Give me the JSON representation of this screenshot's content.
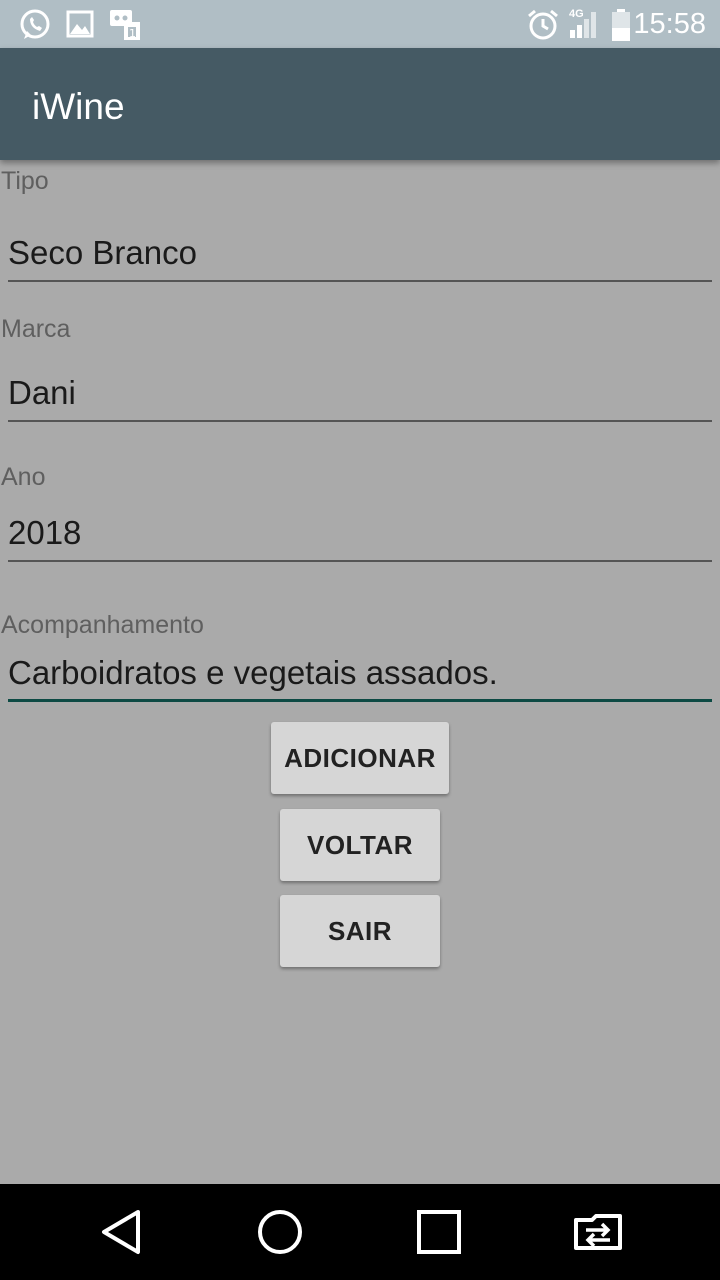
{
  "status_bar": {
    "time": "15:58",
    "network": "4G",
    "icons": [
      "whatsapp-icon",
      "image-icon",
      "messages-icon",
      "alarm-icon",
      "signal-icon",
      "battery-icon"
    ]
  },
  "app_bar": {
    "title": "iWine"
  },
  "form": {
    "tipo": {
      "label": "Tipo",
      "value": "Seco Branco"
    },
    "marca": {
      "label": "Marca",
      "value": "Dani"
    },
    "ano": {
      "label": "Ano",
      "value": "2018"
    },
    "acompanhamento": {
      "label": "Acompanhamento",
      "value": "Carboidratos e vegetais assados."
    }
  },
  "buttons": {
    "adicionar": "ADICIONAR",
    "voltar": "VOLTAR",
    "sair": "SAIR"
  },
  "nav_bar": {
    "icons": [
      "back-icon",
      "home-icon",
      "recents-icon",
      "switch-app-icon"
    ]
  },
  "colors": {
    "status_bar": "#b0bec5",
    "app_bar": "#455a64",
    "background": "#aaaaaa",
    "accent": "#0d4a44",
    "button": "#d6d6d6"
  }
}
